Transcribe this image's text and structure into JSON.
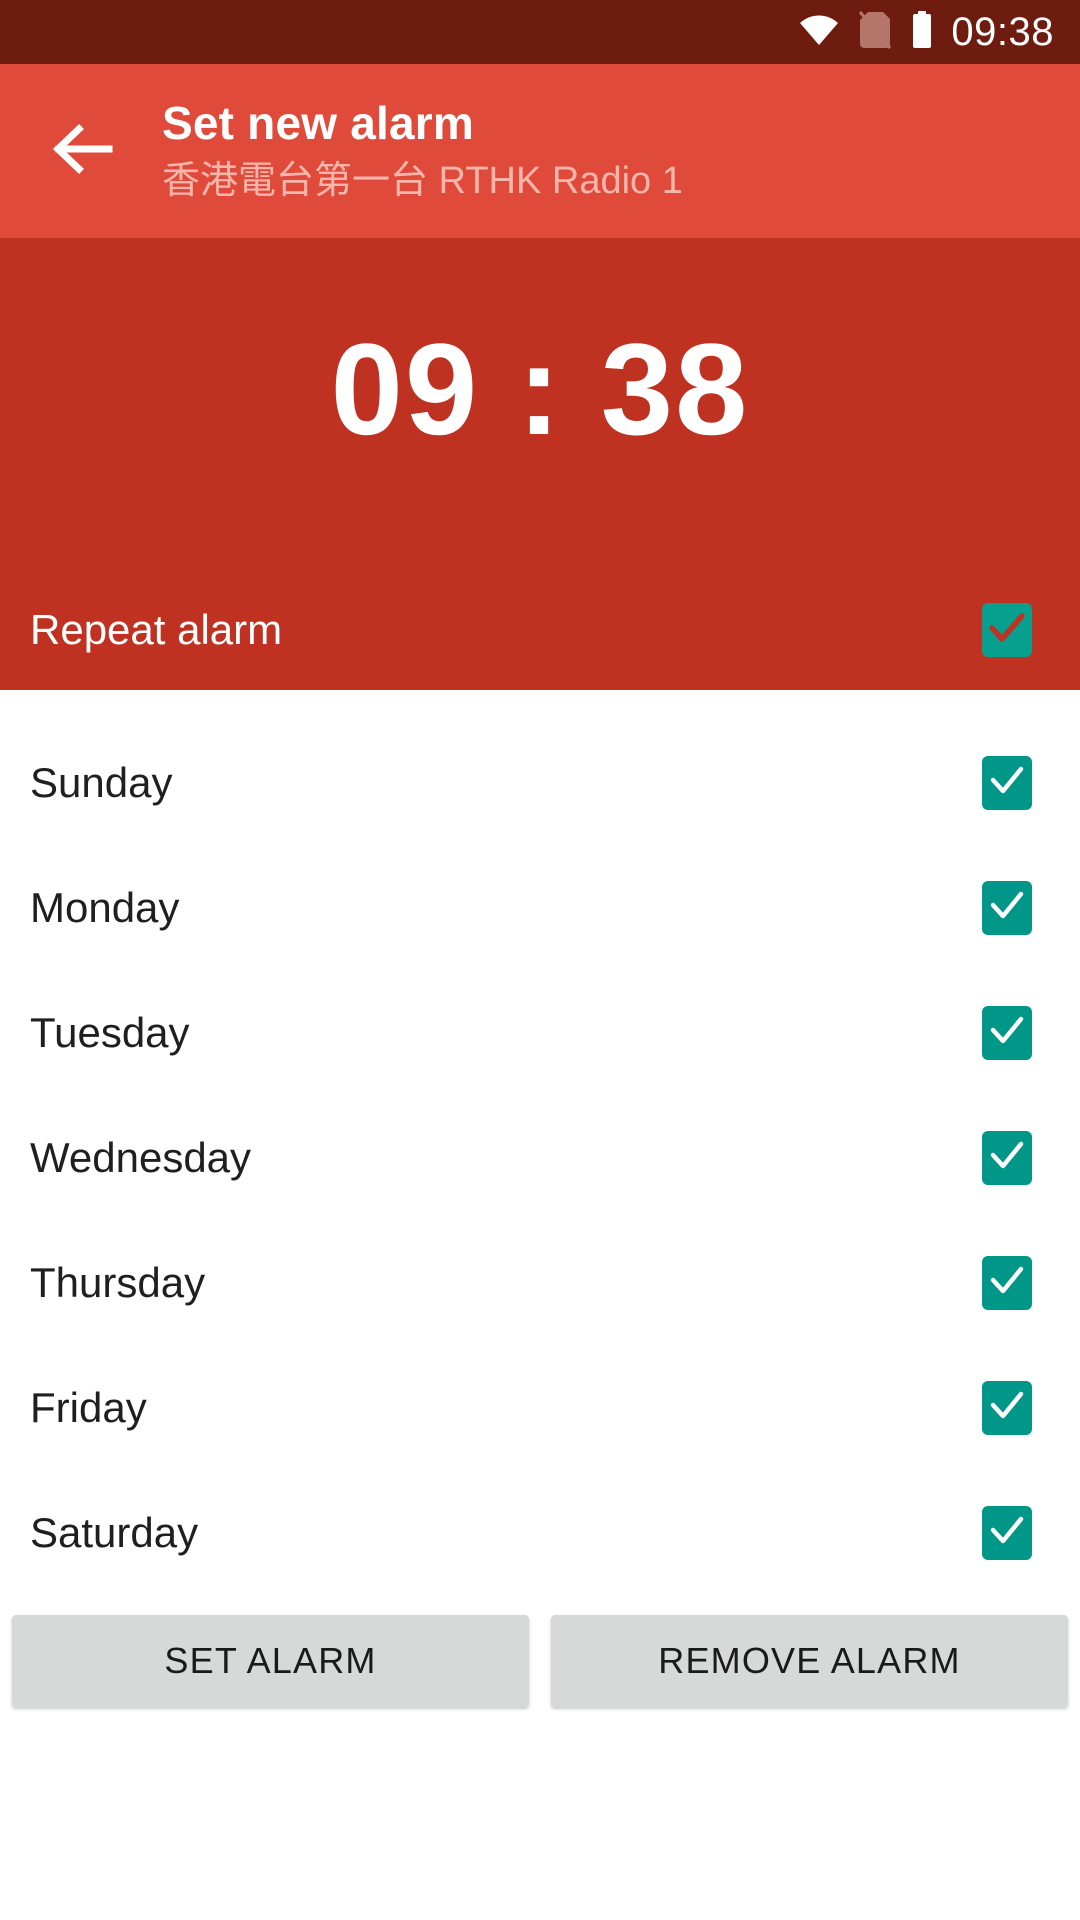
{
  "status_bar": {
    "time": "09:38",
    "icons": [
      "wifi-icon",
      "no-sim-icon",
      "battery-full-icon"
    ],
    "background_color": "#6E1B10"
  },
  "app_bar": {
    "back_icon": "arrow-back-icon",
    "title": "Set new alarm",
    "subtitle": "香港電台第一台 RTHK Radio 1",
    "background_color": "#E04A3A",
    "subtitle_color": "#F6B6AB"
  },
  "time_panel": {
    "background_color": "#BF3222",
    "alarm_time": "09 : 38",
    "repeat": {
      "label": "Repeat alarm",
      "checked": true,
      "checkbox_color": "#07A08E"
    }
  },
  "days": [
    {
      "label": "Sunday",
      "checked": true
    },
    {
      "label": "Monday",
      "checked": true
    },
    {
      "label": "Tuesday",
      "checked": true
    },
    {
      "label": "Wednesday",
      "checked": true
    },
    {
      "label": "Thursday",
      "checked": true
    },
    {
      "label": "Friday",
      "checked": true
    },
    {
      "label": "Saturday",
      "checked": true
    }
  ],
  "checkbox_color": "#009688",
  "buttons": {
    "set_alarm": "SET ALARM",
    "remove_alarm": "REMOVE ALARM",
    "background_color": "#D7D9D8"
  }
}
